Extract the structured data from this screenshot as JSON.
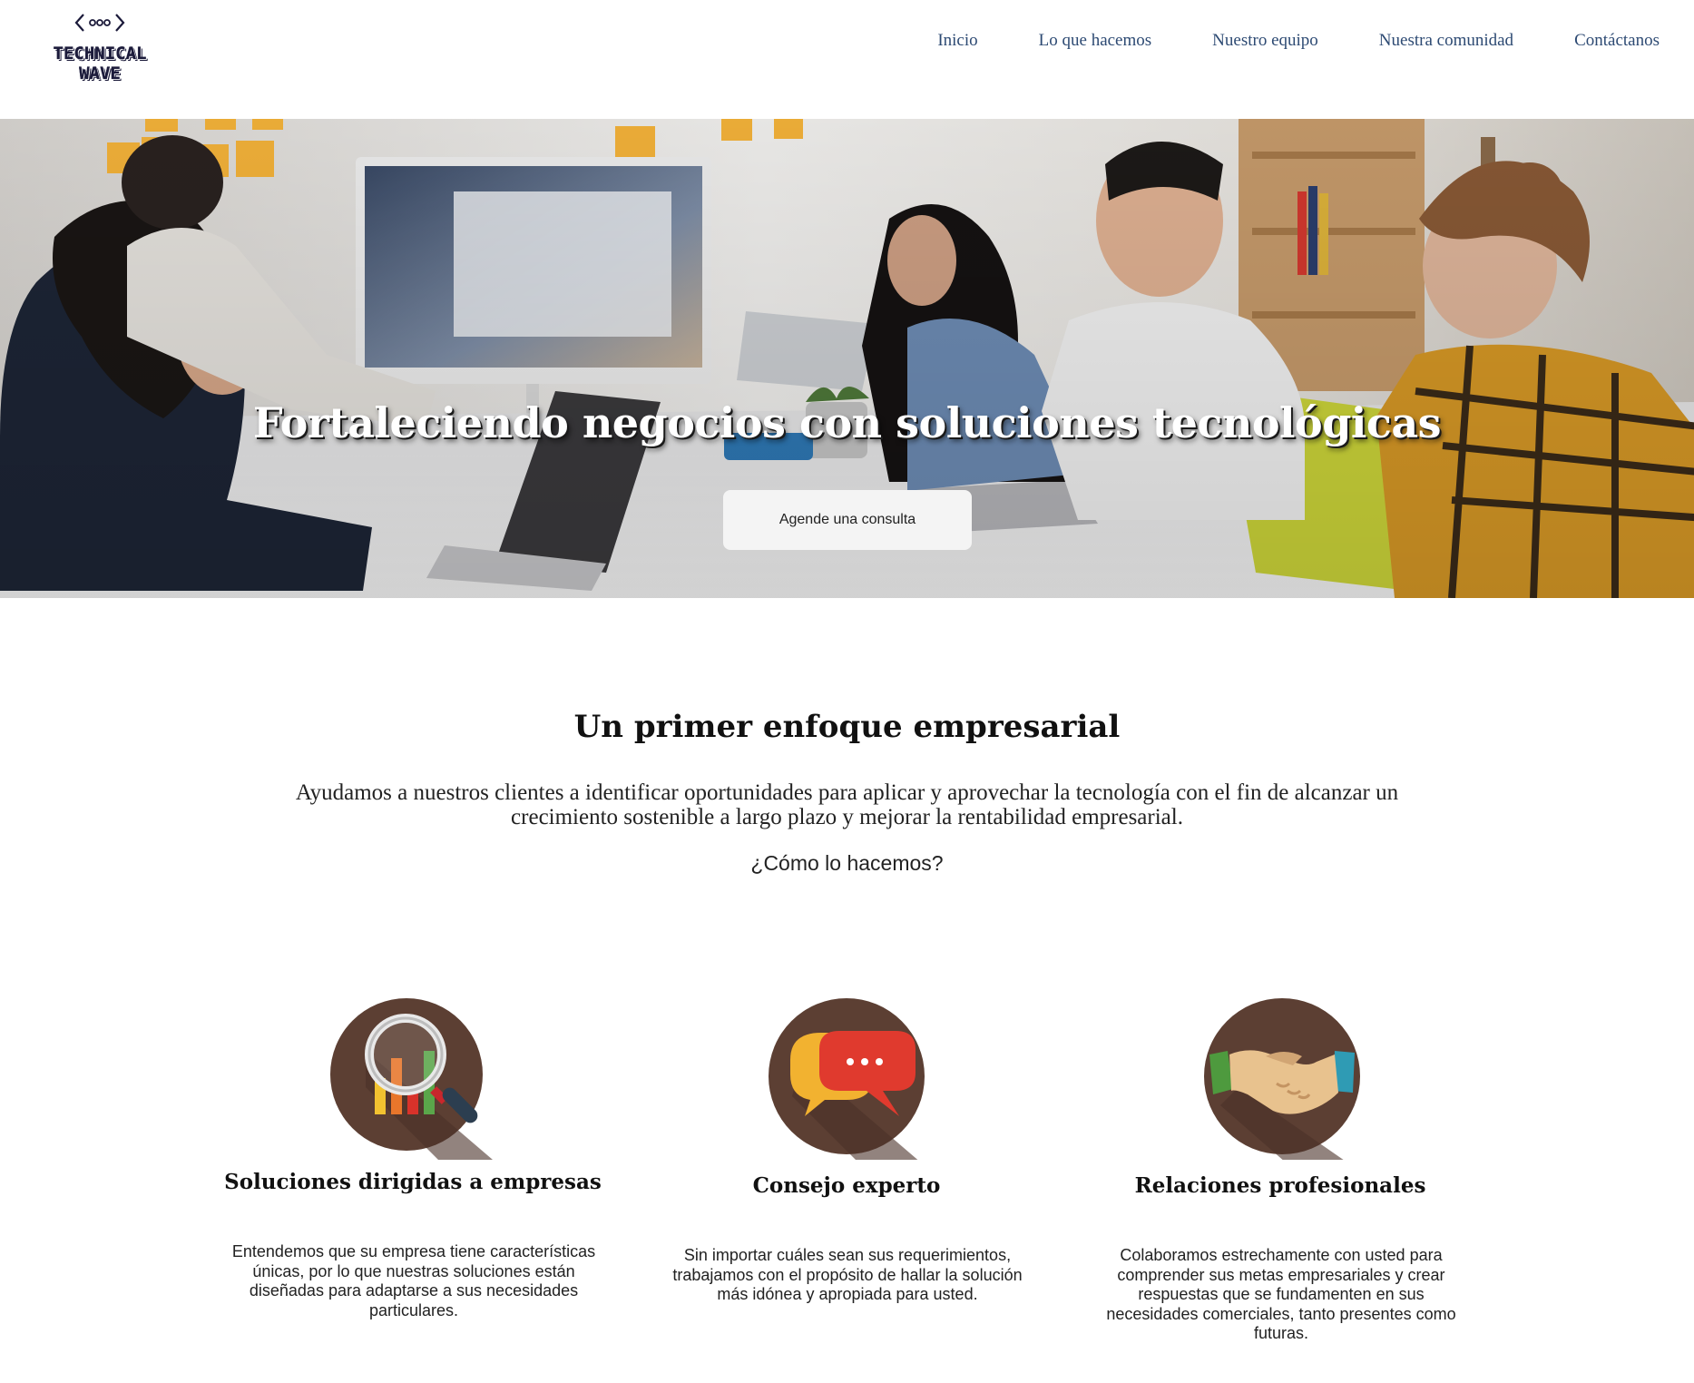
{
  "brand": {
    "name": "TECHNICAL WAVE",
    "mark_icon": "code-dots-icon"
  },
  "nav": {
    "items": [
      {
        "label": "Inicio"
      },
      {
        "label": "Lo que hacemos"
      },
      {
        "label": "Nuestro equipo"
      },
      {
        "label": "Nuestra comunidad"
      },
      {
        "label": "Contáctanos"
      }
    ]
  },
  "hero": {
    "title": "Fortaleciendo negocios con soluciones tecnológicas",
    "cta_label": "Agende una consulta"
  },
  "intro": {
    "title": "Un primer enfoque empresarial",
    "text": "Ayudamos a nuestros clientes a identificar oportunidades para aplicar y aprovechar la tecnología con el fin de alcanzar un crecimiento sostenible a largo plazo y mejorar la rentabilidad empresarial.",
    "question": "¿Cómo lo hacemos?"
  },
  "features": [
    {
      "icon": "magnifier-chart-icon",
      "title": "Soluciones dirigidas a empresas",
      "text": "Entendemos que su empresa tiene características únicas, por lo que nuestras soluciones están diseñadas para adaptarse a sus necesidades particulares."
    },
    {
      "icon": "speech-bubbles-icon",
      "title": "Consejo experto",
      "text": "Sin importar cuáles sean sus requerimientos, trabajamos con el propósito de hallar la solución más idónea y apropiada para usted."
    },
    {
      "icon": "handshake-icon",
      "title": "Relaciones profesionales",
      "text": "Colaboramos estrechamente con usted para comprender sus metas empresariales y crear respuestas que se fundamenten en sus necesidades comerciales, tanto presentes como futuras."
    }
  ],
  "colors": {
    "nav_text": "#2d4a73",
    "icon_background": "#5c3f33",
    "button_background": "#f4f4f4"
  }
}
